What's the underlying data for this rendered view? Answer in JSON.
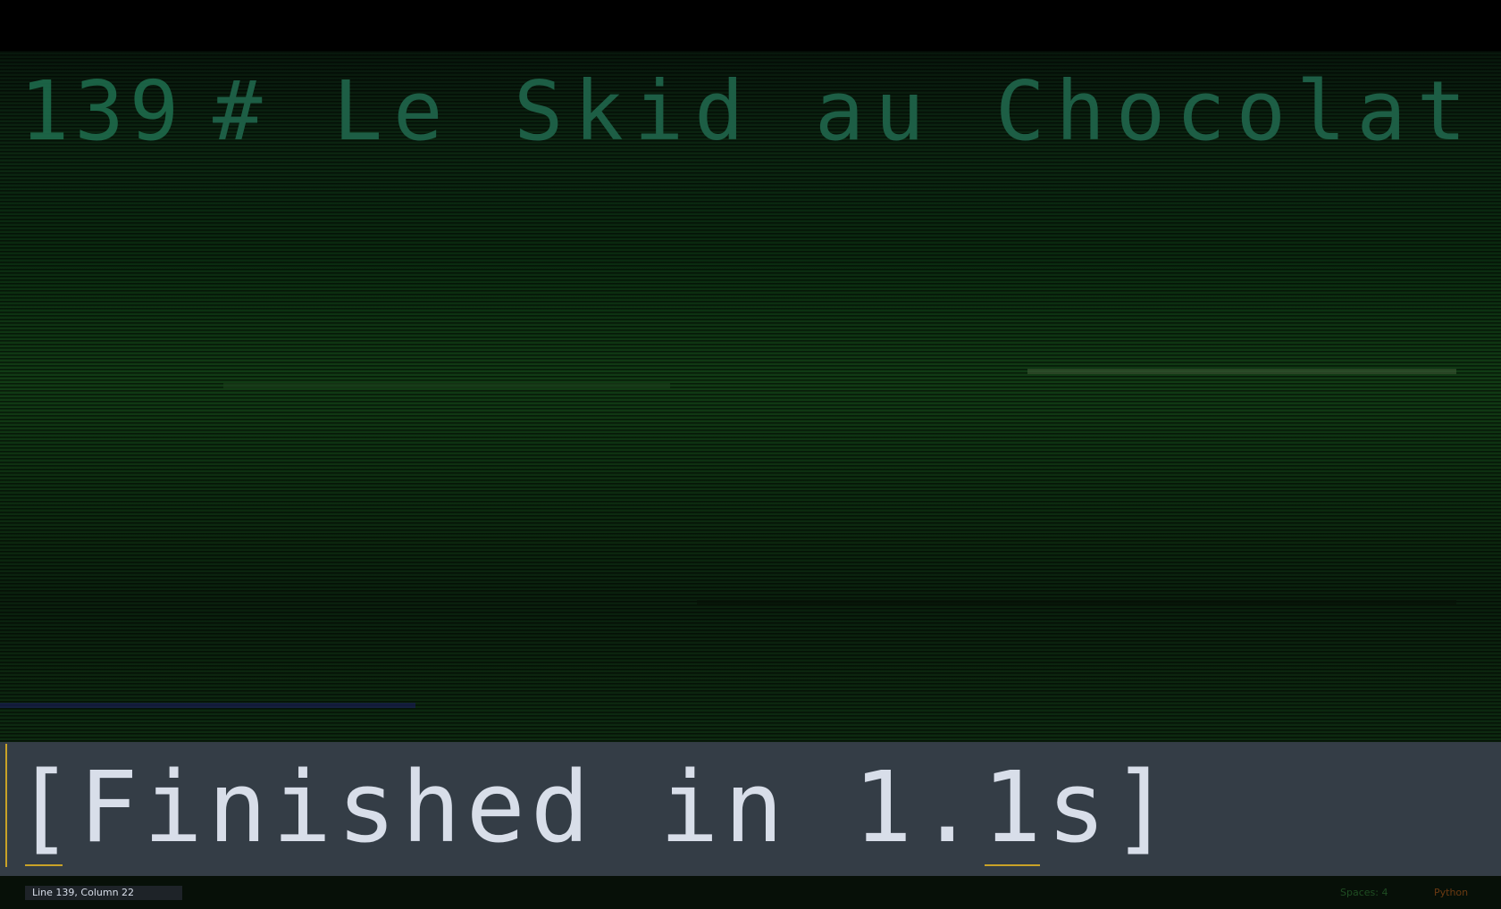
{
  "editor": {
    "line_number": "139",
    "code_text": "# Le Skid au Chocolat"
  },
  "output": {
    "text": "[Finished in 1.1s]"
  },
  "status_bar": {
    "position": "Line 139, Column 22",
    "indentation": "Spaces: 4",
    "syntax": "Python"
  }
}
